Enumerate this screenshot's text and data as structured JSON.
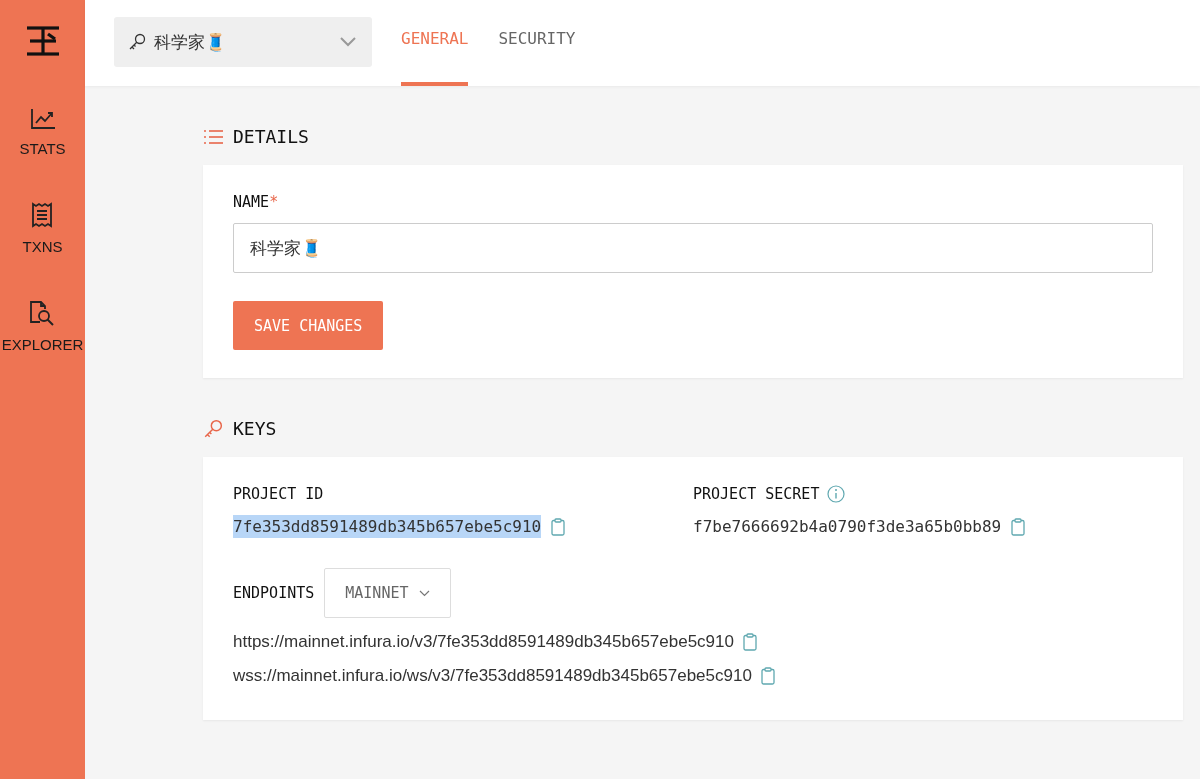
{
  "sidebar": {
    "items": [
      {
        "label": "STATS",
        "kind": "chart"
      },
      {
        "label": "TXNS",
        "kind": "receipt"
      },
      {
        "label": "EXPLORER",
        "kind": "explore"
      }
    ]
  },
  "header": {
    "project_select": {
      "value": "科学家🧵"
    },
    "tabs": [
      {
        "label": "GENERAL",
        "selected": true
      },
      {
        "label": "SECURITY",
        "selected": false
      }
    ]
  },
  "details": {
    "title": "DETAILS",
    "name_label": "NAME",
    "required_mark": "*",
    "name_value": "科学家🧵",
    "save_button": "SAVE CHANGES"
  },
  "keys": {
    "title": "KEYS",
    "project_id": {
      "label": "PROJECT ID",
      "value": "7fe353dd8591489db345b657ebe5c910",
      "selected": true
    },
    "project_secret": {
      "label": "PROJECT SECRET",
      "value": "f7be7666692b4a0790f3de3a65b0bb89",
      "selected": false
    },
    "endpoints_label": "ENDPOINTS",
    "network_select": {
      "value": "MAINNET"
    },
    "endpoints": [
      "https://mainnet.infura.io/v3/7fe353dd8591489db345b657ebe5c910",
      "wss://mainnet.infura.io/ws/v3/7fe353dd8591489db345b657ebe5c910"
    ]
  }
}
